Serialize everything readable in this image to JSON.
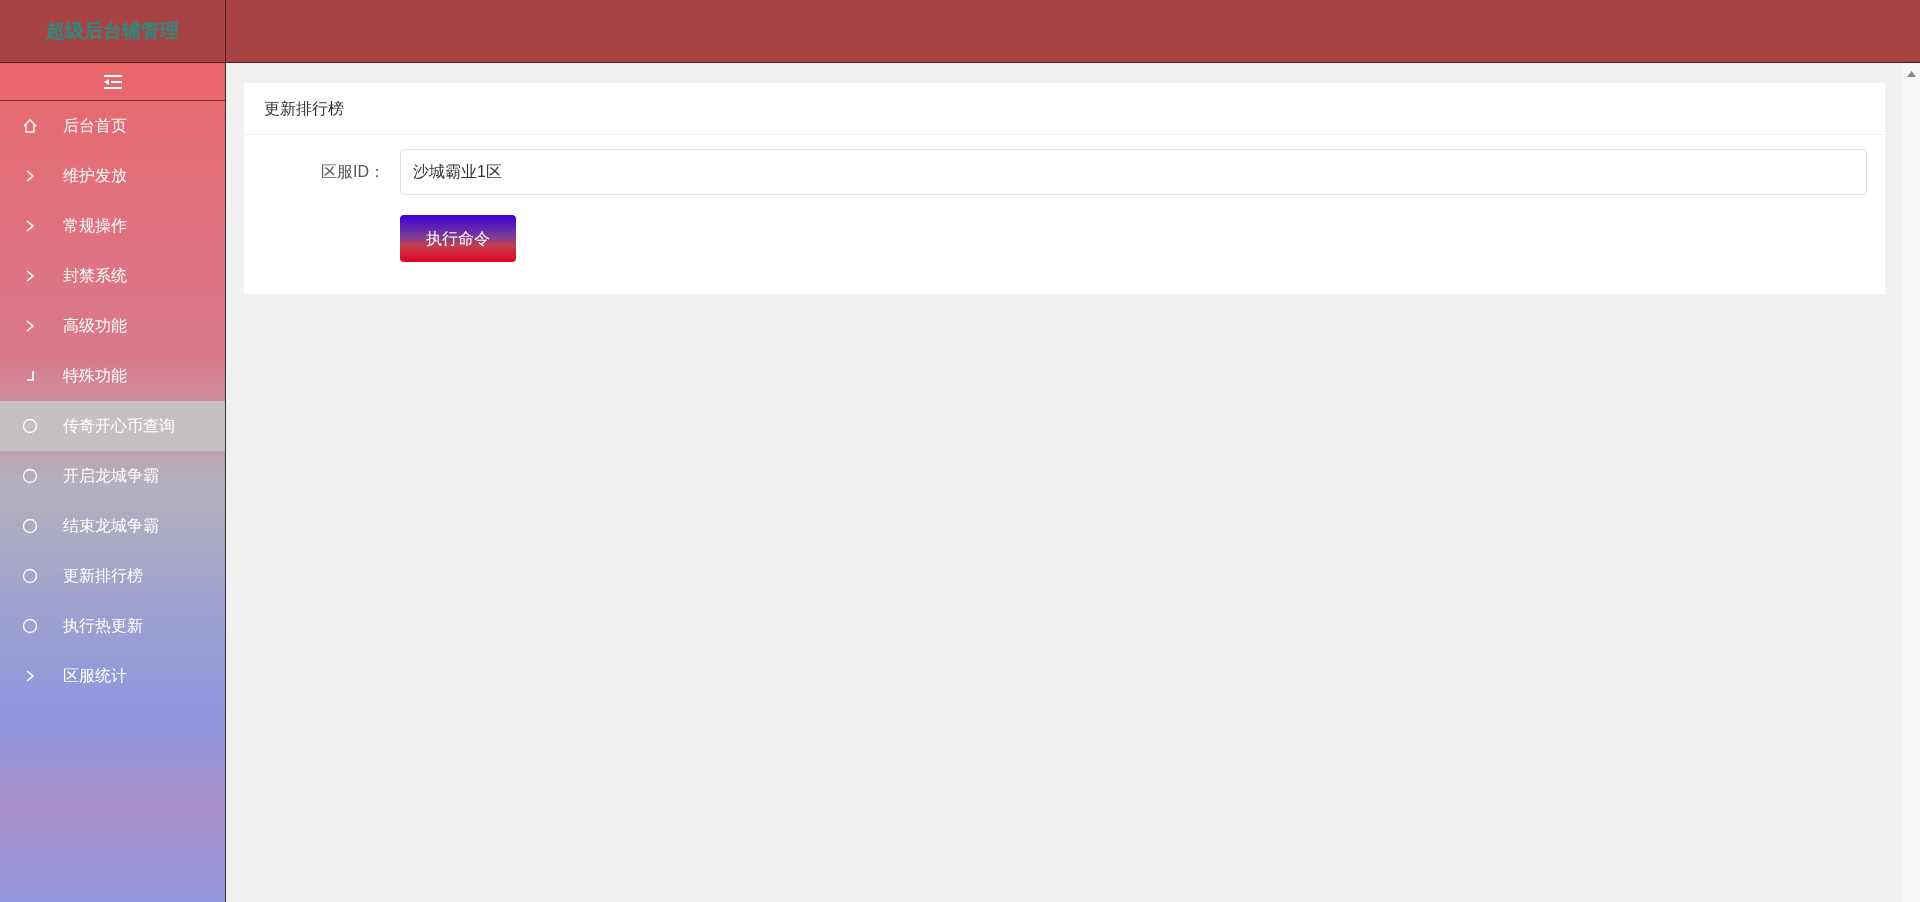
{
  "logo": {
    "title": "超级后台辅管理"
  },
  "sidebar": {
    "items": [
      {
        "kind": "home",
        "label": "后台首页"
      },
      {
        "kind": "folder",
        "label": "维护发放",
        "expanded": false
      },
      {
        "kind": "folder",
        "label": "常规操作",
        "expanded": false
      },
      {
        "kind": "folder",
        "label": "封禁系统",
        "expanded": false
      },
      {
        "kind": "folder",
        "label": "高级功能",
        "expanded": false
      },
      {
        "kind": "folder",
        "label": "特殊功能",
        "expanded": true,
        "children": [
          {
            "label": "传奇开心币查询",
            "selected": true
          },
          {
            "label": "开启龙城争霸",
            "selected": false
          },
          {
            "label": "结束龙城争霸",
            "selected": false
          },
          {
            "label": "更新排行榜",
            "selected": false
          },
          {
            "label": "执行热更新",
            "selected": false
          }
        ]
      },
      {
        "kind": "folder",
        "label": "区服统计",
        "expanded": false
      }
    ]
  },
  "panel": {
    "title": "更新排行榜",
    "field": {
      "label": "区服ID：",
      "value": "沙城霸业1区"
    },
    "button": "执行命令"
  }
}
